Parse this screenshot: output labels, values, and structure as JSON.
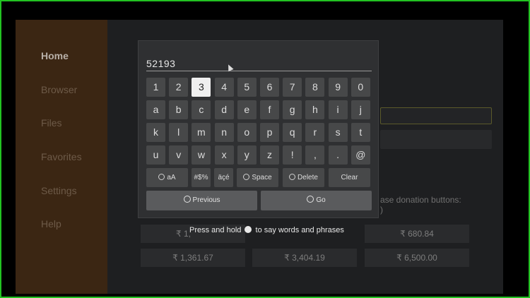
{
  "sidebar": {
    "items": [
      {
        "label": "Home",
        "active": true
      },
      {
        "label": "Browser"
      },
      {
        "label": "Files"
      },
      {
        "label": "Favorites"
      },
      {
        "label": "Settings"
      },
      {
        "label": "Help"
      }
    ]
  },
  "background": {
    "donation_text": "ase donation buttons:",
    "donation_text2": ")",
    "amounts": [
      "₹ 1,",
      "₹ 680.84",
      "₹ 1,361.67",
      "₹ 3,404.19",
      "₹ 6,500.00"
    ]
  },
  "keyboard": {
    "entry_value": "52193",
    "rows": [
      [
        "1",
        "2",
        "3",
        "4",
        "5",
        "6",
        "7",
        "8",
        "9",
        "0"
      ],
      [
        "a",
        "b",
        "c",
        "d",
        "e",
        "f",
        "g",
        "h",
        "i",
        "j"
      ],
      [
        "k",
        "l",
        "m",
        "n",
        "o",
        "p",
        "q",
        "r",
        "s",
        "t"
      ],
      [
        "u",
        "v",
        "w",
        "x",
        "y",
        "z",
        "!",
        ",",
        ".",
        "@"
      ]
    ],
    "selected_key": "3",
    "modifiers": {
      "case": "aA",
      "symbols": "#$%",
      "accents": "äçé",
      "space": "Space",
      "delete": "Delete",
      "clear": "Clear"
    },
    "previous_label": "Previous",
    "go_label": "Go"
  },
  "hint": {
    "before": "Press and hold",
    "after": "to say words and phrases"
  },
  "colors": {
    "frame": "#22c322",
    "sidebar": "#3b2613",
    "selected_key": "#efefef"
  }
}
